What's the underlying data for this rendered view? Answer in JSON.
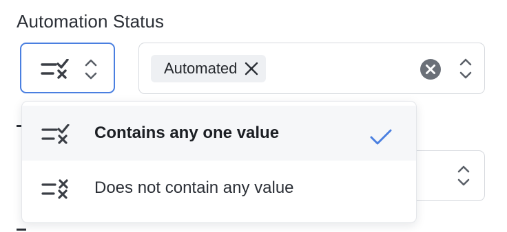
{
  "field": {
    "label": "Automation Status"
  },
  "operator_select": {
    "icon": "list-check-icon",
    "selected_index": 0
  },
  "value_select": {
    "chips": [
      {
        "label": "Automated"
      }
    ],
    "clear_icon": "clear-circle-icon"
  },
  "dropdown": {
    "options": [
      {
        "label": "Contains any one value",
        "icon": "list-check-icon",
        "selected": true
      },
      {
        "label": "Does not contain any value",
        "icon": "list-x-icon",
        "selected": false
      }
    ]
  },
  "colors": {
    "accent": "#4a7fe0",
    "text": "#2b2f36",
    "chip_bg": "#eef0f3",
    "hover_bg": "#f6f7f9"
  }
}
